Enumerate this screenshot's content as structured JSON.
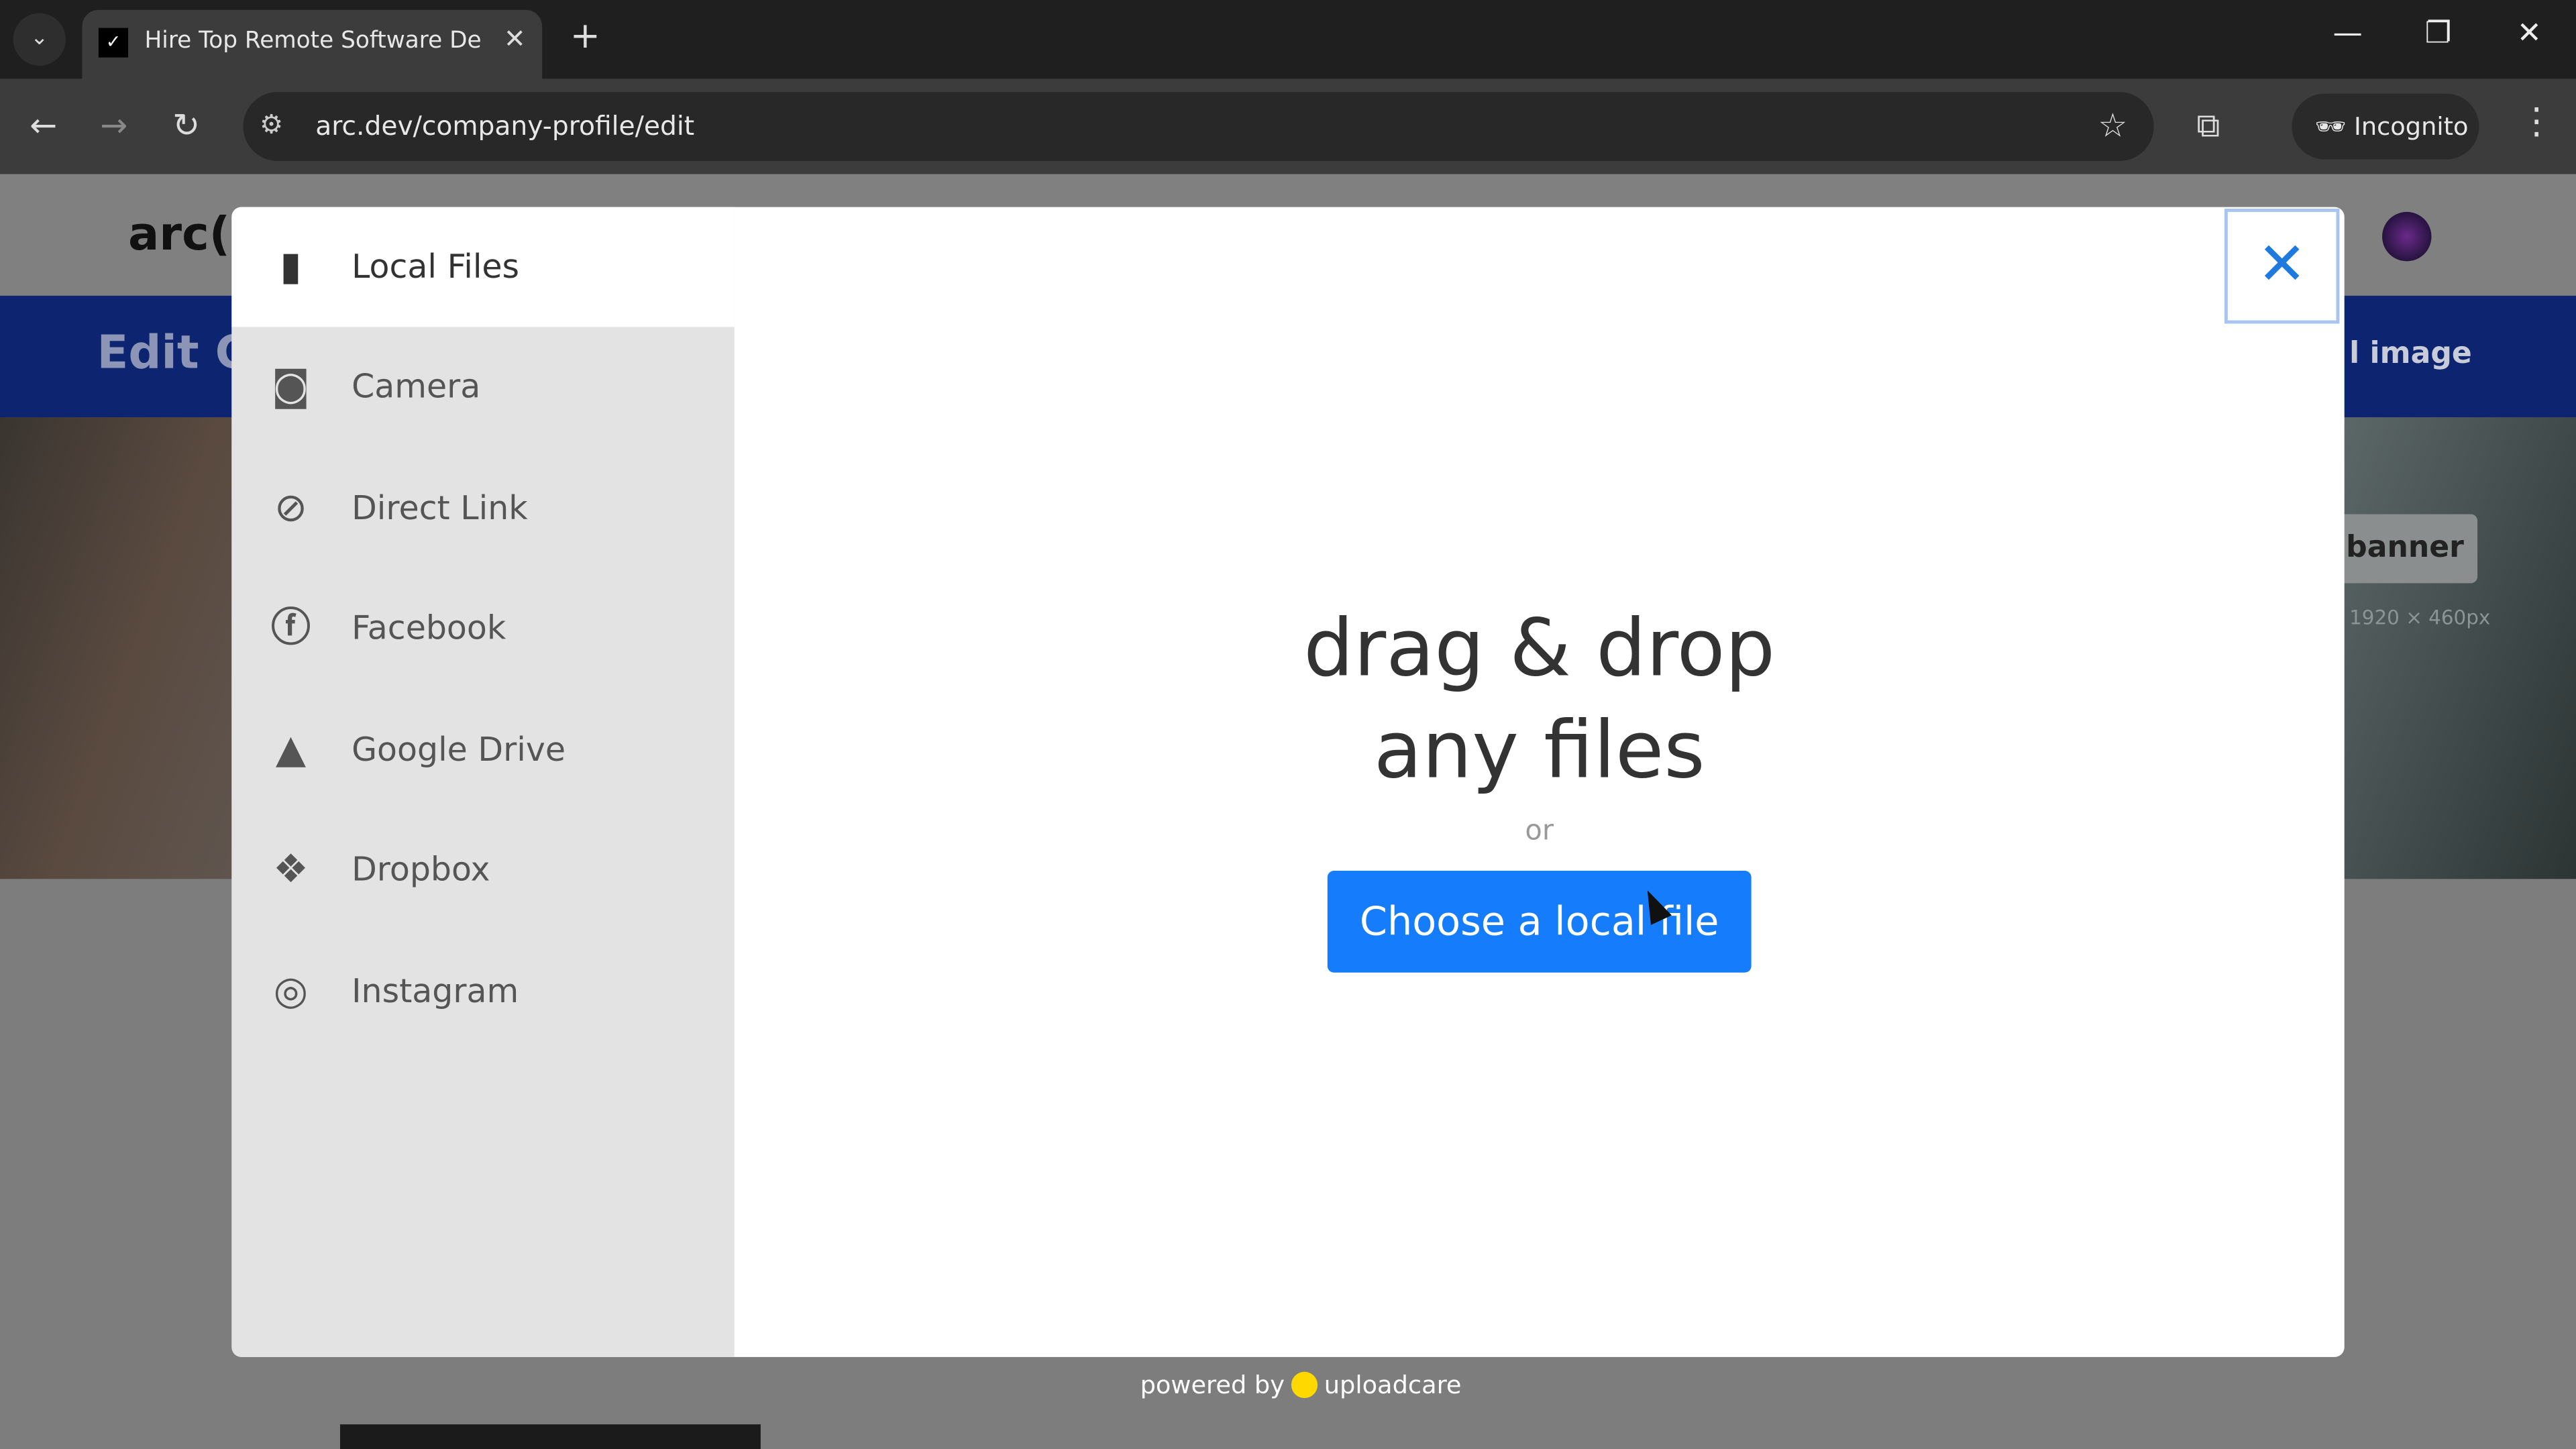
{
  "browser": {
    "tab_title": "Hire Top Remote Software Developers",
    "url": "arc.dev/company-profile/edit",
    "incognito_label": "Incognito",
    "new_tab": "+",
    "tab_close": "✕"
  },
  "page": {
    "logo": "arc()",
    "band_title": "Edit C",
    "band_button": "l image",
    "banner_button": "banner",
    "banner_hint": "1920 × 460px"
  },
  "modal": {
    "sources": [
      {
        "label": "Local Files",
        "icon": "file-icon",
        "active": true
      },
      {
        "label": "Camera",
        "icon": "camera-icon"
      },
      {
        "label": "Direct Link",
        "icon": "link-icon"
      },
      {
        "label": "Facebook",
        "icon": "facebook-icon"
      },
      {
        "label": "Google Drive",
        "icon": "google-drive-icon"
      },
      {
        "label": "Dropbox",
        "icon": "dropbox-icon"
      },
      {
        "label": "Instagram",
        "icon": "instagram-icon"
      }
    ],
    "drop_line1": "drag & drop",
    "drop_line2": "any files",
    "or": "or",
    "choose_button": "Choose a local file",
    "close": "✕",
    "accent": "#157cfc"
  },
  "footer": {
    "powered_by": "powered by",
    "brand": "uploadcare"
  }
}
